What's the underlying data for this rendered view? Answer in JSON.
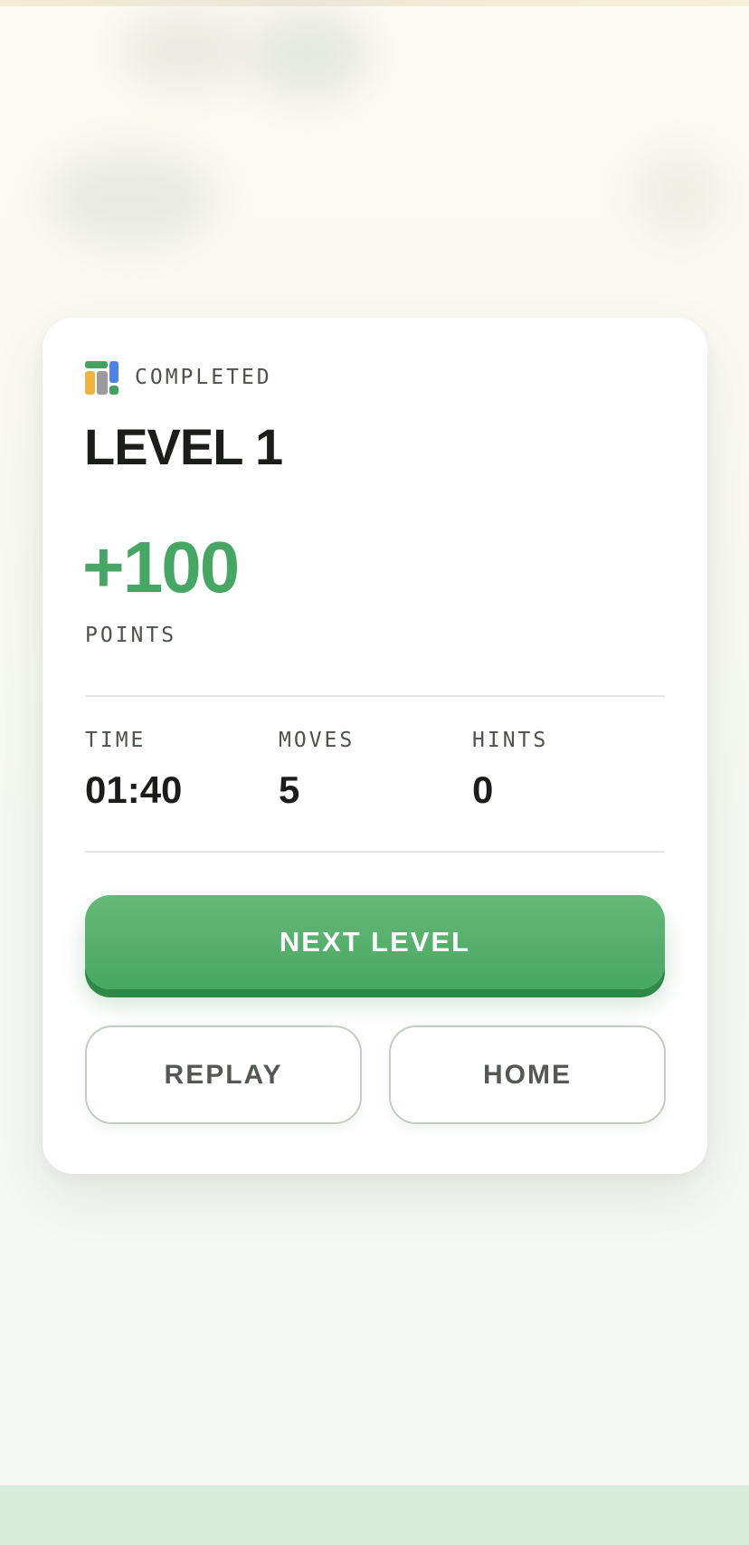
{
  "result": {
    "status_label": "COMPLETED",
    "level_title": "LEVEL 1",
    "points_value": "+100",
    "points_label": "POINTS"
  },
  "stats": [
    {
      "label": "TIME",
      "value": "01:40"
    },
    {
      "label": "MOVES",
      "value": "5"
    },
    {
      "label": "HINTS",
      "value": "0"
    }
  ],
  "actions": {
    "next_label": "NEXT LEVEL",
    "replay_label": "REPLAY",
    "home_label": "HOME"
  },
  "colors": {
    "accent_green": "#46a663",
    "button_green": "#4fae68",
    "text_dark": "#1b1d1b",
    "text_muted": "#4d524d"
  },
  "icons": {
    "logo": "blocks-logo-icon"
  }
}
